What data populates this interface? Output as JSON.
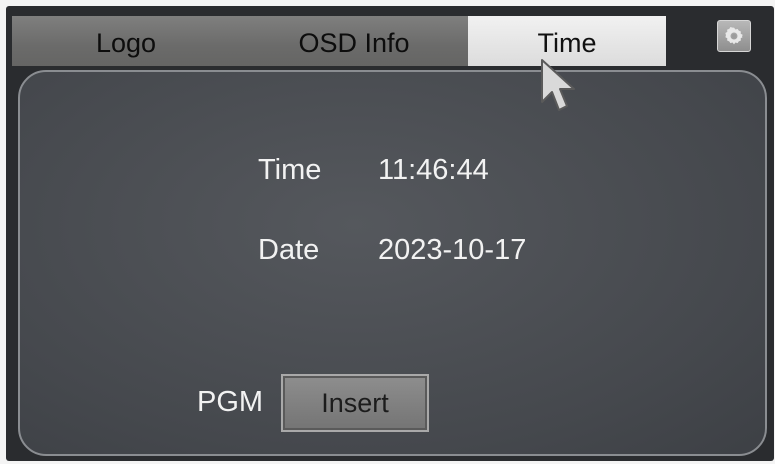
{
  "tabs": [
    {
      "label": "Logo",
      "selected": false
    },
    {
      "label": "OSD Info",
      "selected": false
    },
    {
      "label": "Time",
      "selected": true
    }
  ],
  "toolbar": {
    "settings_icon": "gear-icon"
  },
  "panel": {
    "time_label": "Time",
    "time_value": "11:46:44",
    "date_label": "Date",
    "date_value": "2023-10-17",
    "pgm_label": "PGM",
    "insert_label": "Insert"
  },
  "colors": {
    "tab_selected": "#e6e6e6",
    "tab_bar": "#747473",
    "panel_bg": "#4a4d52",
    "panel_border": "#8a8d91",
    "window_bg": "#2a2c2f"
  }
}
